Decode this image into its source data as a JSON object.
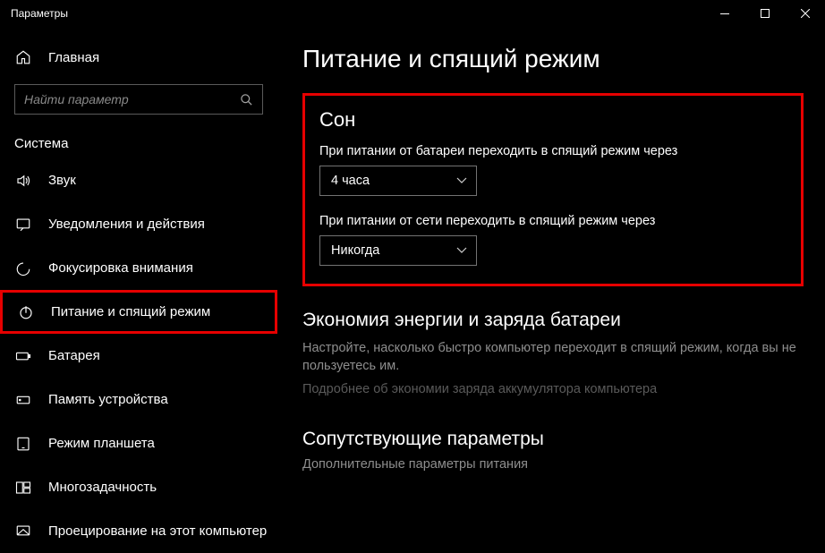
{
  "window": {
    "title": "Параметры"
  },
  "sidebar": {
    "home": "Главная",
    "search_placeholder": "Найти параметр",
    "group_label": "Система",
    "items": [
      {
        "label": "Звук",
        "icon": "sound"
      },
      {
        "label": "Уведомления и действия",
        "icon": "notifications"
      },
      {
        "label": "Фокусировка внимания",
        "icon": "focus"
      },
      {
        "label": "Питание и спящий режим",
        "icon": "power",
        "active": true
      },
      {
        "label": "Батарея",
        "icon": "battery"
      },
      {
        "label": "Память устройства",
        "icon": "storage"
      },
      {
        "label": "Режим планшета",
        "icon": "tablet"
      },
      {
        "label": "Многозадачность",
        "icon": "multitask"
      },
      {
        "label": "Проецирование на этот компьютер",
        "icon": "project"
      }
    ]
  },
  "page": {
    "title": "Питание и спящий режим",
    "sleep": {
      "heading": "Сон",
      "battery_label": "При питании от батареи переходить в спящий режим через",
      "battery_value": "4 часа",
      "plugged_label": "При питании от сети переходить в спящий режим через",
      "plugged_value": "Никогда"
    },
    "energy": {
      "heading": "Экономия энергии и заряда батареи",
      "desc": "Настройте, насколько быстро компьютер переходит в спящий режим, когда вы не пользуетесь им.",
      "more": "Подробнее об экономии заряда аккумулятора компьютера"
    },
    "related": {
      "heading": "Сопутствующие параметры",
      "link": "Дополнительные параметры питания"
    }
  }
}
